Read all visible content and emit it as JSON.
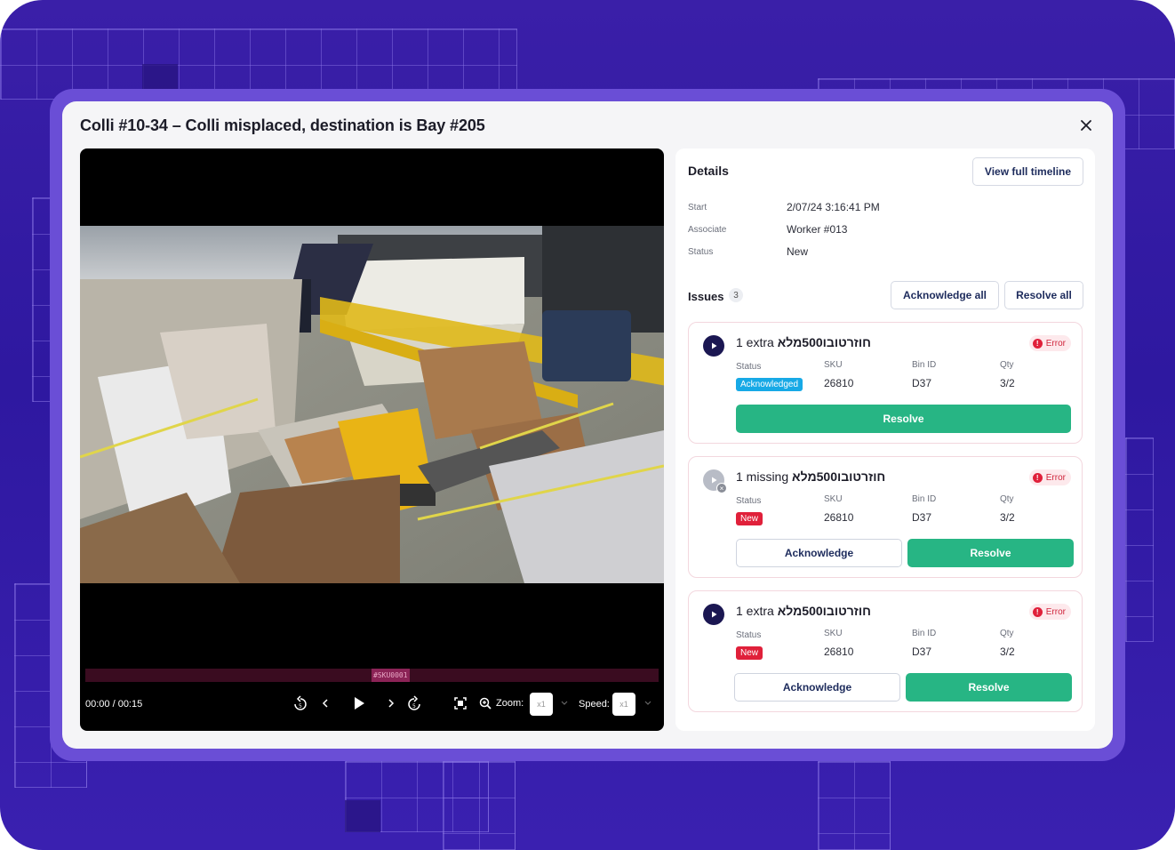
{
  "modal": {
    "title": "Colli #10-34 – Colli misplaced, destination is Bay #205"
  },
  "video": {
    "time": "00:00 / 00:15",
    "marker": "#SKU0001",
    "zoom_label": "Zoom:",
    "zoom_value": "x1",
    "speed_label": "Speed:",
    "speed_value": "x1"
  },
  "details": {
    "title": "Details",
    "view_timeline": "View full timeline",
    "fields": [
      {
        "label": "Start",
        "value": "2/07/24 3:16:41 PM"
      },
      {
        "label": "Associate",
        "value": "Worker #013"
      },
      {
        "label": "Status",
        "value": "New"
      }
    ]
  },
  "issues": {
    "label": "Issues",
    "count": "3",
    "acknowledge_all": "Acknowledge all",
    "resolve_all": "Resolve all",
    "columns": {
      "status": "Status",
      "sku": "SKU",
      "bin": "Bin ID",
      "qty": "Qty"
    },
    "items": [
      {
        "prefix": "1 extra ",
        "product": "חוזרטובו500מלא",
        "severity": "Error",
        "status": "Acknowledged",
        "sku": "26810",
        "bin": "D37",
        "qty": "3/2",
        "resolve": "Resolve"
      },
      {
        "prefix": "1 missing ",
        "product": "חוזרטובו500מלא",
        "severity": "Error",
        "status": "New",
        "sku": "26810",
        "bin": "D37",
        "qty": "3/2",
        "acknowledge": "Acknowledge",
        "resolve": "Resolve"
      },
      {
        "prefix": "1 extra ",
        "product": "חוזרטובו500מלא",
        "severity": "Error",
        "status": "New",
        "sku": "26810",
        "bin": "D37",
        "qty": "3/2",
        "acknowledge": "Acknowledge",
        "resolve": "Resolve"
      }
    ]
  },
  "colors": {
    "background": "#3a1fa8",
    "frame": "#6a4ed6",
    "resolve": "#27b584",
    "acknowledged": "#17a9e6",
    "new": "#e0203a",
    "error": "#d0253c"
  }
}
